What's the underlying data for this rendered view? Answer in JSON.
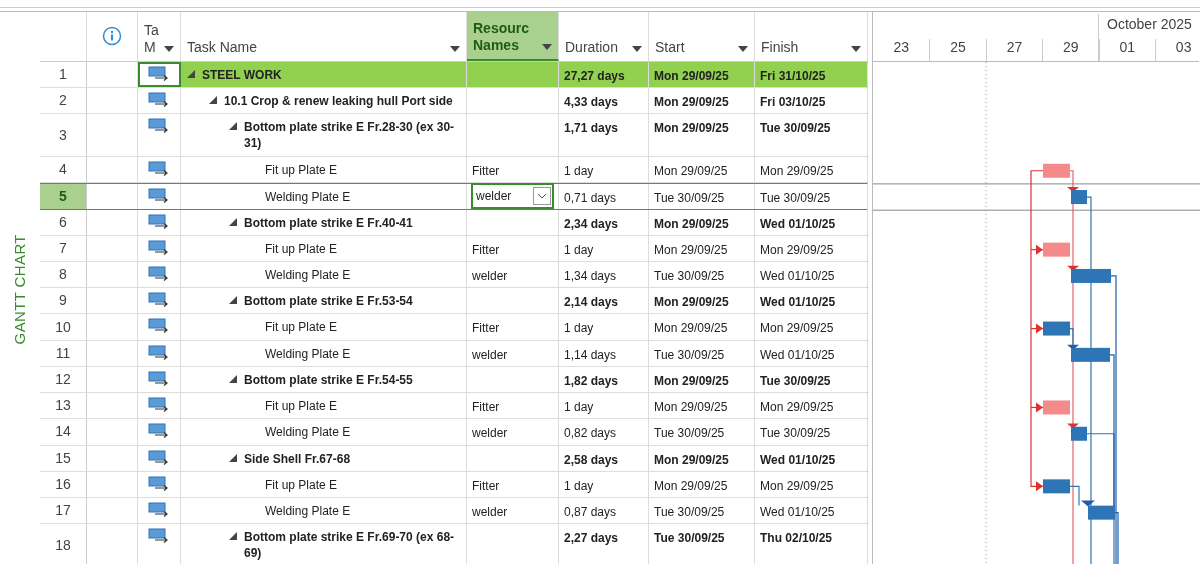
{
  "side_label": "GANTT CHART",
  "columns": [
    {
      "kind": "info",
      "selected": false
    },
    {
      "kind": "text",
      "lines": [
        "Ta",
        "M"
      ],
      "selected": false,
      "filter": true
    },
    {
      "kind": "text",
      "lines": [
        "Task Name"
      ],
      "selected": false,
      "filter": true
    },
    {
      "kind": "text",
      "lines": [
        "Resourc",
        "Names"
      ],
      "selected": true,
      "filter": true
    },
    {
      "kind": "text",
      "lines": [
        "Duration"
      ],
      "selected": false,
      "filter": true
    },
    {
      "kind": "text",
      "lines": [
        "Start"
      ],
      "selected": false,
      "filter": true
    },
    {
      "kind": "text",
      "lines": [
        "Finish"
      ],
      "selected": false,
      "filter": true
    }
  ],
  "timescale": {
    "month": "October 2025",
    "days": [
      "23",
      "25",
      "27",
      "29",
      "01",
      "03"
    ]
  },
  "rows": [
    {
      "kind": "summary",
      "num": "1",
      "name": "STEEL WORK",
      "resource": "",
      "duration": "27,27 days",
      "start": "Mon 29/09/25",
      "finish": "Fri 31/10/25",
      "expanded": true,
      "highlighted": true,
      "selected": false,
      "children": [
        {
          "kind": "summary",
          "num": "2",
          "name": "10.1 Crop & renew leaking hull Port side",
          "duration": "4,33 days",
          "start": "Mon 29/09/25",
          "finish": "Fri 03/10/25",
          "expanded": true,
          "highlighted": false,
          "selected": false,
          "children": [
            {
              "kind": "summary",
              "num": "3",
              "name": "Bottom plate strike E Fr.28-30 (ex 30-31)",
              "duration": "1,71 days",
              "start": "Mon 29/09/25",
              "finish": "Tue 30/09/25",
              "expanded": true,
              "highlighted": false,
              "selected": false,
              "children": [
                {
                  "kind": "task",
                  "num": "4",
                  "name": "Fit up Plate E",
                  "resource": "Fitter",
                  "duration": "1 day",
                  "start": "Mon 29/09/25",
                  "finish": "Mon 29/09/25",
                  "critical": true,
                  "highlighted": false,
                  "selected": false
                },
                {
                  "kind": "task",
                  "num": "5",
                  "name": "Welding Plate E",
                  "resource": "welder",
                  "duration": "0,71 days",
                  "start": "Tue 30/09/25",
                  "finish": "Tue 30/09/25",
                  "critical": false,
                  "highlighted": false,
                  "selected": true
                }
              ]
            },
            {
              "kind": "summary",
              "num": "6",
              "name": "Bottom plate strike E Fr.40-41",
              "duration": "2,34 days",
              "start": "Mon 29/09/25",
              "finish": "Wed 01/10/25",
              "expanded": true,
              "highlighted": false,
              "selected": false,
              "children": [
                {
                  "kind": "task",
                  "num": "7",
                  "name": "Fit up Plate E",
                  "resource": "Fitter",
                  "duration": "1 day",
                  "start": "Mon 29/09/25",
                  "finish": "Mon 29/09/25",
                  "critical": true,
                  "highlighted": false,
                  "selected": false
                },
                {
                  "kind": "task",
                  "num": "8",
                  "name": "Welding Plate E",
                  "resource": "welder",
                  "duration": "1,34 days",
                  "start": "Tue 30/09/25",
                  "finish": "Wed 01/10/25",
                  "critical": false,
                  "highlighted": false,
                  "selected": false
                }
              ]
            },
            {
              "kind": "summary",
              "num": "9",
              "name": "Bottom plate strike E Fr.53-54",
              "duration": "2,14 days",
              "start": "Mon 29/09/25",
              "finish": "Wed 01/10/25",
              "expanded": true,
              "highlighted": false,
              "selected": false,
              "children": [
                {
                  "kind": "task",
                  "num": "10",
                  "name": "Fit up Plate E",
                  "resource": "Fitter",
                  "duration": "1 day",
                  "start": "Mon 29/09/25",
                  "finish": "Mon 29/09/25",
                  "critical": false,
                  "highlighted": false,
                  "selected": false
                },
                {
                  "kind": "task",
                  "num": "11",
                  "name": "Welding Plate E",
                  "resource": "welder",
                  "duration": "1,14 days",
                  "start": "Tue 30/09/25",
                  "finish": "Wed 01/10/25",
                  "critical": false,
                  "highlighted": false,
                  "selected": false
                }
              ]
            },
            {
              "kind": "summary",
              "num": "12",
              "name": "Bottom plate strike E Fr.54-55",
              "duration": "1,82 days",
              "start": "Mon 29/09/25",
              "finish": "Tue 30/09/25",
              "expanded": true,
              "highlighted": false,
              "selected": false,
              "children": [
                {
                  "kind": "task",
                  "num": "13",
                  "name": "Fit up Plate E",
                  "resource": "Fitter",
                  "duration": "1 day",
                  "start": "Mon 29/09/25",
                  "finish": "Mon 29/09/25",
                  "critical": true,
                  "highlighted": false,
                  "selected": false
                },
                {
                  "kind": "task",
                  "num": "14",
                  "name": "Welding Plate E",
                  "resource": "welder",
                  "duration": "0,82 days",
                  "start": "Tue 30/09/25",
                  "finish": "Tue 30/09/25",
                  "critical": false,
                  "highlighted": false,
                  "selected": false
                }
              ]
            },
            {
              "kind": "summary",
              "num": "15",
              "name": "Side Shell Fr.67-68",
              "duration": "2,58 days",
              "start": "Mon 29/09/25",
              "finish": "Wed 01/10/25",
              "expanded": true,
              "highlighted": false,
              "selected": false,
              "children": [
                {
                  "kind": "task",
                  "num": "16",
                  "name": "Fit up Plate E",
                  "resource": "Fitter",
                  "duration": "1 day",
                  "start": "Mon 29/09/25",
                  "finish": "Mon 29/09/25",
                  "critical": false,
                  "highlighted": false,
                  "selected": false
                },
                {
                  "kind": "task",
                  "num": "17",
                  "name": "Welding Plate E",
                  "resource": "welder",
                  "duration": "0,87 days",
                  "start": "Tue 30/09/25",
                  "finish": "Wed 01/10/25",
                  "critical": false,
                  "highlighted": false,
                  "selected": false
                }
              ]
            },
            {
              "kind": "summary",
              "num": "18",
              "name": "Bottom plate strike E Fr.69-70 (ex 68-69)",
              "duration": "2,27 days",
              "start": "Tue 30/09/25",
              "finish": "Thu 02/10/25",
              "expanded": true,
              "highlighted": false,
              "selected": false
            }
          ]
        }
      ]
    }
  ]
}
